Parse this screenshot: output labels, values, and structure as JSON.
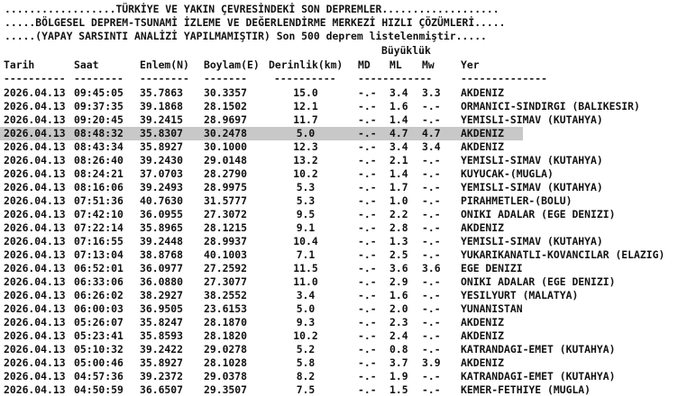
{
  "header": {
    "line1": "..................TÜRKİYE VE YAKIN ÇEVRESİNDEKİ SON DEPREMLER...................",
    "line2": ".....BÖLGESEL DEPREM-TSUNAMİ İZLEME VE DEĞERLENDİRME MERKEZİ HIZLI ÇÖZÜMLERİ.....",
    "line3": ".....(YAPAY SARSINTI ANALİZİ YAPILMAMIŞTIR) Son 500 deprem listelenmiştir....."
  },
  "magnitude_group": "Büyüklük",
  "columns": {
    "date": "Tarih",
    "time": "Saat",
    "lat": "Enlem(N)",
    "lon": "Boylam(E)",
    "depth": "Derinlik(km)",
    "md": "MD",
    "ml": "ML",
    "mw": "Mw",
    "location": "Yer"
  },
  "separators": {
    "date": "----------",
    "time": "--------",
    "lat": "--------",
    "lon": "-------",
    "depth": "----------",
    "md": "------------",
    "location": "--------------"
  },
  "highlight_color": "#c8c8c8",
  "rows": [
    {
      "date": "2026.04.13",
      "time": "09:45:05",
      "lat": "35.7863",
      "lon": "30.3357",
      "depth": "15.0",
      "md": "-.-",
      "ml": "3.4",
      "mw": "3.3",
      "location": "AKDENIZ"
    },
    {
      "date": "2026.04.13",
      "time": "09:37:35",
      "lat": "39.1868",
      "lon": "28.1502",
      "depth": "12.1",
      "md": "-.-",
      "ml": "1.6",
      "mw": "-.-",
      "location": "ORMANICI-SINDIRGI (BALIKESIR)"
    },
    {
      "date": "2026.04.13",
      "time": "09:20:45",
      "lat": "39.2415",
      "lon": "28.9697",
      "depth": "11.7",
      "md": "-.-",
      "ml": "1.4",
      "mw": "-.-",
      "location": "YEMISLI-SIMAV (KUTAHYA)"
    },
    {
      "date": "2026.04.13",
      "time": "08:48:32",
      "lat": "35.8307",
      "lon": "30.2478",
      "depth": "5.0",
      "md": "-.-",
      "ml": "4.7",
      "mw": "4.7",
      "location": "AKDENIZ",
      "highlight": true
    },
    {
      "date": "2026.04.13",
      "time": "08:43:34",
      "lat": "35.8927",
      "lon": "30.1000",
      "depth": "12.3",
      "md": "-.-",
      "ml": "3.4",
      "mw": "3.4",
      "location": "AKDENIZ"
    },
    {
      "date": "2026.04.13",
      "time": "08:26:40",
      "lat": "39.2430",
      "lon": "29.0148",
      "depth": "13.2",
      "md": "-.-",
      "ml": "2.1",
      "mw": "-.-",
      "location": "YEMISLI-SIMAV (KUTAHYA)"
    },
    {
      "date": "2026.04.13",
      "time": "08:24:21",
      "lat": "37.0703",
      "lon": "28.2790",
      "depth": "10.2",
      "md": "-.-",
      "ml": "1.4",
      "mw": "-.-",
      "location": "KUYUCAK-(MUGLA)"
    },
    {
      "date": "2026.04.13",
      "time": "08:16:06",
      "lat": "39.2493",
      "lon": "28.9975",
      "depth": "5.3",
      "md": "-.-",
      "ml": "1.7",
      "mw": "-.-",
      "location": "YEMISLI-SIMAV (KUTAHYA)"
    },
    {
      "date": "2026.04.13",
      "time": "07:51:36",
      "lat": "40.7630",
      "lon": "31.5777",
      "depth": "5.3",
      "md": "-.-",
      "ml": "1.0",
      "mw": "-.-",
      "location": "PIRAHMETLER-(BOLU)"
    },
    {
      "date": "2026.04.13",
      "time": "07:42:10",
      "lat": "36.0955",
      "lon": "27.3072",
      "depth": "9.5",
      "md": "-.-",
      "ml": "2.2",
      "mw": "-.-",
      "location": "ONIKI ADALAR (EGE DENIZI)"
    },
    {
      "date": "2026.04.13",
      "time": "07:22:14",
      "lat": "35.8965",
      "lon": "28.1215",
      "depth": "9.1",
      "md": "-.-",
      "ml": "2.8",
      "mw": "-.-",
      "location": "AKDENIZ"
    },
    {
      "date": "2026.04.13",
      "time": "07:16:55",
      "lat": "39.2448",
      "lon": "28.9937",
      "depth": "10.4",
      "md": "-.-",
      "ml": "1.3",
      "mw": "-.-",
      "location": "YEMISLI-SIMAV (KUTAHYA)"
    },
    {
      "date": "2026.04.13",
      "time": "07:13:04",
      "lat": "38.8768",
      "lon": "40.1003",
      "depth": "7.1",
      "md": "-.-",
      "ml": "2.5",
      "mw": "-.-",
      "location": "YUKARIKANATLI-KOVANCILAR (ELAZIG)"
    },
    {
      "date": "2026.04.13",
      "time": "06:52:01",
      "lat": "36.0977",
      "lon": "27.2592",
      "depth": "11.5",
      "md": "-.-",
      "ml": "3.6",
      "mw": "3.6",
      "location": "EGE DENIZI"
    },
    {
      "date": "2026.04.13",
      "time": "06:33:06",
      "lat": "36.0880",
      "lon": "27.3077",
      "depth": "11.0",
      "md": "-.-",
      "ml": "2.9",
      "mw": "-.-",
      "location": "ONIKI ADALAR (EGE DENIZI)"
    },
    {
      "date": "2026.04.13",
      "time": "06:26:02",
      "lat": "38.2927",
      "lon": "38.2552",
      "depth": "3.4",
      "md": "-.-",
      "ml": "1.6",
      "mw": "-.-",
      "location": "YESILYURT (MALATYA)"
    },
    {
      "date": "2026.04.13",
      "time": "06:00:03",
      "lat": "36.9505",
      "lon": "23.6153",
      "depth": "5.0",
      "md": "-.-",
      "ml": "2.0",
      "mw": "-.-",
      "location": "YUNANISTAN"
    },
    {
      "date": "2026.04.13",
      "time": "05:26:07",
      "lat": "35.8247",
      "lon": "28.1870",
      "depth": "9.3",
      "md": "-.-",
      "ml": "2.3",
      "mw": "-.-",
      "location": "AKDENIZ"
    },
    {
      "date": "2026.04.13",
      "time": "05:23:41",
      "lat": "35.8593",
      "lon": "28.1820",
      "depth": "10.2",
      "md": "-.-",
      "ml": "2.4",
      "mw": "-.-",
      "location": "AKDENIZ"
    },
    {
      "date": "2026.04.13",
      "time": "05:10:32",
      "lat": "39.2422",
      "lon": "29.0278",
      "depth": "5.2",
      "md": "-.-",
      "ml": "0.8",
      "mw": "-.-",
      "location": "KATRANDAGI-EMET (KUTAHYA)"
    },
    {
      "date": "2026.04.13",
      "time": "05:00:46",
      "lat": "35.8927",
      "lon": "28.1028",
      "depth": "5.8",
      "md": "-.-",
      "ml": "3.7",
      "mw": "3.9",
      "location": "AKDENIZ"
    },
    {
      "date": "2026.04.13",
      "time": "04:57:36",
      "lat": "39.2372",
      "lon": "29.0378",
      "depth": "8.2",
      "md": "-.-",
      "ml": "1.9",
      "mw": "-.-",
      "location": "KATRANDAGI-EMET (KUTAHYA)"
    },
    {
      "date": "2026.04.13",
      "time": "04:50:59",
      "lat": "36.6507",
      "lon": "29.3507",
      "depth": "7.5",
      "md": "-.-",
      "ml": "1.5",
      "mw": "-.-",
      "location": "KEMER-FETHIYE (MUGLA)"
    }
  ]
}
